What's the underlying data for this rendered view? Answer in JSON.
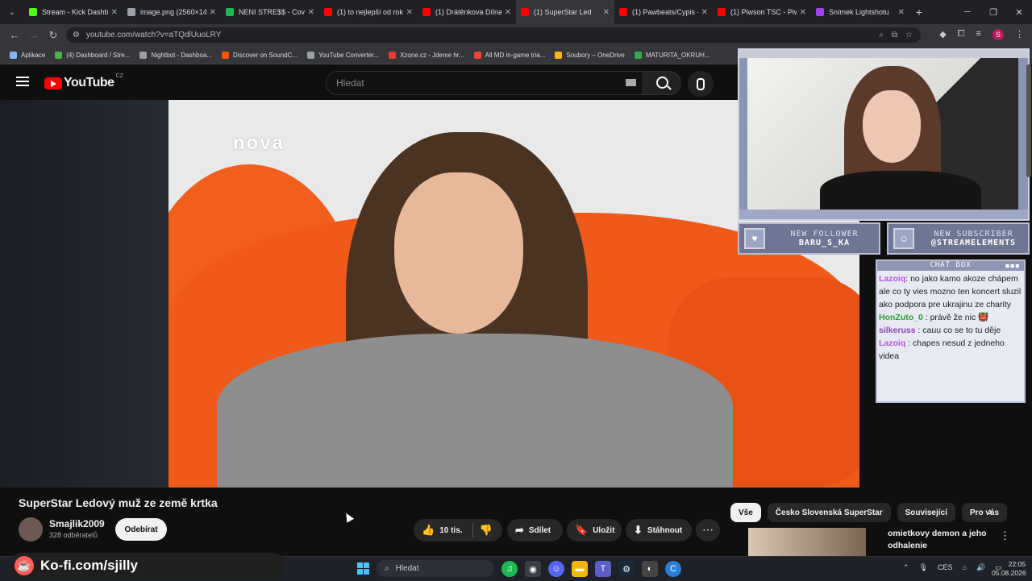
{
  "browser": {
    "tabs": [
      {
        "label": "Stream - Kick Dashbo",
        "color": "#53fc18",
        "active": false
      },
      {
        "label": "image.png (2560×14",
        "color": "#9aa0a6",
        "active": false
      },
      {
        "label": "NENI STRE$$ - Cover",
        "color": "#1db954",
        "active": false
      },
      {
        "label": "(1) to nejlepší od rok",
        "color": "#ff0000",
        "active": false
      },
      {
        "label": "(1) Drátěnkova Dílna",
        "color": "#ff0000",
        "active": false
      },
      {
        "label": "(1) SuperStar Led",
        "color": "#ff0000",
        "active": true
      },
      {
        "label": "(1) Pawbeats/Cypis -",
        "color": "#ff0000",
        "active": false
      },
      {
        "label": "(1) Piwson TSC - Piw",
        "color": "#ff0000",
        "active": false
      },
      {
        "label": "Snímek Lightshotu",
        "color": "#a142f4",
        "active": false
      }
    ],
    "url": "youtube.com/watch?v=aTQdlUuoLRY",
    "profile_initial": "S",
    "bookmarks": [
      {
        "label": "Aplikace",
        "color": "#8ab4f8"
      },
      {
        "label": "(4) Dashboard / Stre...",
        "color": "#4caf50"
      },
      {
        "label": "Nightbot - Dashboa...",
        "color": "#9e9e9e"
      },
      {
        "label": "Discover on SoundC...",
        "color": "#ff5500"
      },
      {
        "label": "YouTube Converter...",
        "color": "#9aa0a6"
      },
      {
        "label": "Xzone.cz - Jdeme hr...",
        "color": "#e53935"
      },
      {
        "label": "All MD in-game tria...",
        "color": "#f44336"
      },
      {
        "label": "Soubory – OneDrive",
        "color": "#ffb900"
      },
      {
        "label": "MATURITA_OKRUH...",
        "color": "#34a853"
      }
    ]
  },
  "youtube": {
    "logo_text": "YouTube",
    "country": "CZ",
    "search_placeholder": "Hledat",
    "video_title": "SuperStar Ledový muž ze země krtka",
    "channel_name": "Smajlik2009",
    "subscribers": "328 odběratelů",
    "subscribe_label": "Odebírat",
    "like_count": "10 tis.",
    "share_label": "Sdílet",
    "save_label": "Uložit",
    "download_label": "Stáhnout",
    "chips": [
      "Vše",
      "Česko Slovenská SuperStar",
      "Související",
      "Pro vás"
    ],
    "rec_title": "omietkovy demon a jeho odhalenie",
    "video_watermark": "nova"
  },
  "stream_overlay": {
    "follower_heading": "NEW FOLLOWER",
    "follower_name": "BARU_S_KA",
    "subscriber_heading": "NEW SUBSCRIBER",
    "subscriber_name": "@STREAMELEMENTS",
    "chat_heading": "CHAT BOX",
    "chat": [
      {
        "user": "Lazoiq",
        "user_color": "#b455d9",
        "text": ": no jako kamo akoze chápem ale co ty vies mozno ten koncert sluzil ako podpora pre ukrajinu ze charity"
      },
      {
        "user": "HonZuto_0",
        "user_color": "#2e9e3a",
        "text": " : právě že nic 👹"
      },
      {
        "user": "silkeruss",
        "user_color": "#8e44ad",
        "text": " : cauu co se to tu děje"
      },
      {
        "user": "Lazoiq",
        "user_color": "#b455d9",
        "text": " : chapes nesud z jedneho videa"
      }
    ],
    "kofi_text": "Ko-fi.com/sjilly"
  },
  "taskbar": {
    "search_label": "Hledat",
    "language": "CES",
    "time": "22:05",
    "date": "05.08.2026"
  }
}
